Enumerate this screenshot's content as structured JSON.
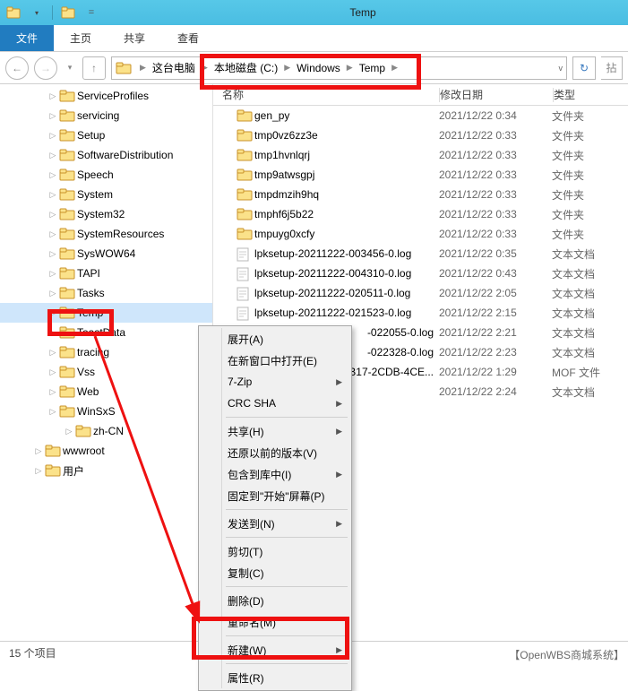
{
  "window": {
    "title": "Temp"
  },
  "tabs": {
    "file": "文件",
    "home": "主页",
    "share": "共享",
    "view": "查看"
  },
  "breadcrumb": {
    "segments": [
      "这台电脑",
      "本地磁盘 (C:)",
      "Windows",
      "Temp"
    ]
  },
  "tree": {
    "items": [
      {
        "label": "ServiceProfiles",
        "indent": 52
      },
      {
        "label": "servicing",
        "indent": 52
      },
      {
        "label": "Setup",
        "indent": 52
      },
      {
        "label": "SoftwareDistribution",
        "indent": 52
      },
      {
        "label": "Speech",
        "indent": 52
      },
      {
        "label": "System",
        "indent": 52
      },
      {
        "label": "System32",
        "indent": 52
      },
      {
        "label": "SystemResources",
        "indent": 52
      },
      {
        "label": "SysWOW64",
        "indent": 52
      },
      {
        "label": "TAPI",
        "indent": 52
      },
      {
        "label": "Tasks",
        "indent": 52
      },
      {
        "label": "Temp",
        "indent": 52,
        "selected": true
      },
      {
        "label": "ToastData",
        "indent": 52
      },
      {
        "label": "tracing",
        "indent": 52
      },
      {
        "label": "Vss",
        "indent": 52
      },
      {
        "label": "Web",
        "indent": 52
      },
      {
        "label": "WinSxS",
        "indent": 52
      },
      {
        "label": "zh-CN",
        "indent": 70
      },
      {
        "label": "wwwroot",
        "indent": 36
      },
      {
        "label": "用户",
        "indent": 36
      }
    ]
  },
  "columns": {
    "name": "名称",
    "modified": "修改日期",
    "type": "类型"
  },
  "files": {
    "rows": [
      {
        "icon": "folder",
        "name": "gen_py",
        "date": "2021/12/22 0:34",
        "type": "文件夹"
      },
      {
        "icon": "folder",
        "name": "tmp0vz6zz3e",
        "date": "2021/12/22 0:33",
        "type": "文件夹"
      },
      {
        "icon": "folder",
        "name": "tmp1hvnlqrj",
        "date": "2021/12/22 0:33",
        "type": "文件夹"
      },
      {
        "icon": "folder",
        "name": "tmp9atwsgpj",
        "date": "2021/12/22 0:33",
        "type": "文件夹"
      },
      {
        "icon": "folder",
        "name": "tmpdmzih9hq",
        "date": "2021/12/22 0:33",
        "type": "文件夹"
      },
      {
        "icon": "folder",
        "name": "tmphf6j5b22",
        "date": "2021/12/22 0:33",
        "type": "文件夹"
      },
      {
        "icon": "folder",
        "name": "tmpuyg0xcfy",
        "date": "2021/12/22 0:33",
        "type": "文件夹"
      },
      {
        "icon": "doc",
        "name": "lpksetup-20211222-003456-0.log",
        "date": "2021/12/22 0:35",
        "type": "文本文档"
      },
      {
        "icon": "doc",
        "name": "lpksetup-20211222-004310-0.log",
        "date": "2021/12/22 0:43",
        "type": "文本文档"
      },
      {
        "icon": "doc",
        "name": "lpksetup-20211222-020511-0.log",
        "date": "2021/12/22 2:05",
        "type": "文本文档"
      },
      {
        "icon": "doc",
        "name": "lpksetup-20211222-021523-0.log",
        "date": "2021/12/22 2:15",
        "type": "文本文档"
      },
      {
        "icon": "doc",
        "name": "-022055-0.log",
        "date": "2021/12/22 2:21",
        "type": "文本文档",
        "partial": true
      },
      {
        "icon": "doc",
        "name": "-022328-0.log",
        "date": "2021/12/22 2:23",
        "type": "文本文档",
        "partial": true
      },
      {
        "icon": "doc",
        "name": "3DB17-2CDB-4CE...",
        "date": "2021/12/22 1:29",
        "type": "MOF 文件",
        "partial": true
      },
      {
        "icon": "doc",
        "name": "",
        "date": "2021/12/22 2:24",
        "type": "文本文档",
        "partial": true
      }
    ]
  },
  "context_menu": {
    "items": [
      {
        "label": "展开(A)",
        "sep": false
      },
      {
        "label": "在新窗口中打开(E)",
        "sep": false
      },
      {
        "label": "7-Zip",
        "sub": true
      },
      {
        "label": "CRC SHA",
        "sub": true,
        "sep": true
      },
      {
        "label": "共享(H)",
        "sub": true
      },
      {
        "label": "还原以前的版本(V)"
      },
      {
        "label": "包含到库中(I)",
        "sub": true
      },
      {
        "label": "固定到\"开始\"屏幕(P)",
        "sep": true
      },
      {
        "label": "发送到(N)",
        "sub": true,
        "sep": true
      },
      {
        "label": "剪切(T)"
      },
      {
        "label": "复制(C)",
        "sep": true
      },
      {
        "label": "删除(D)"
      },
      {
        "label": "重命名(M)",
        "sep": true
      },
      {
        "label": "新建(W)",
        "sub": true,
        "sep": true
      },
      {
        "label": "属性(R)"
      }
    ]
  },
  "status": {
    "item_count": "15 个项目"
  },
  "watermark": "【OpenWBS商城系统】"
}
